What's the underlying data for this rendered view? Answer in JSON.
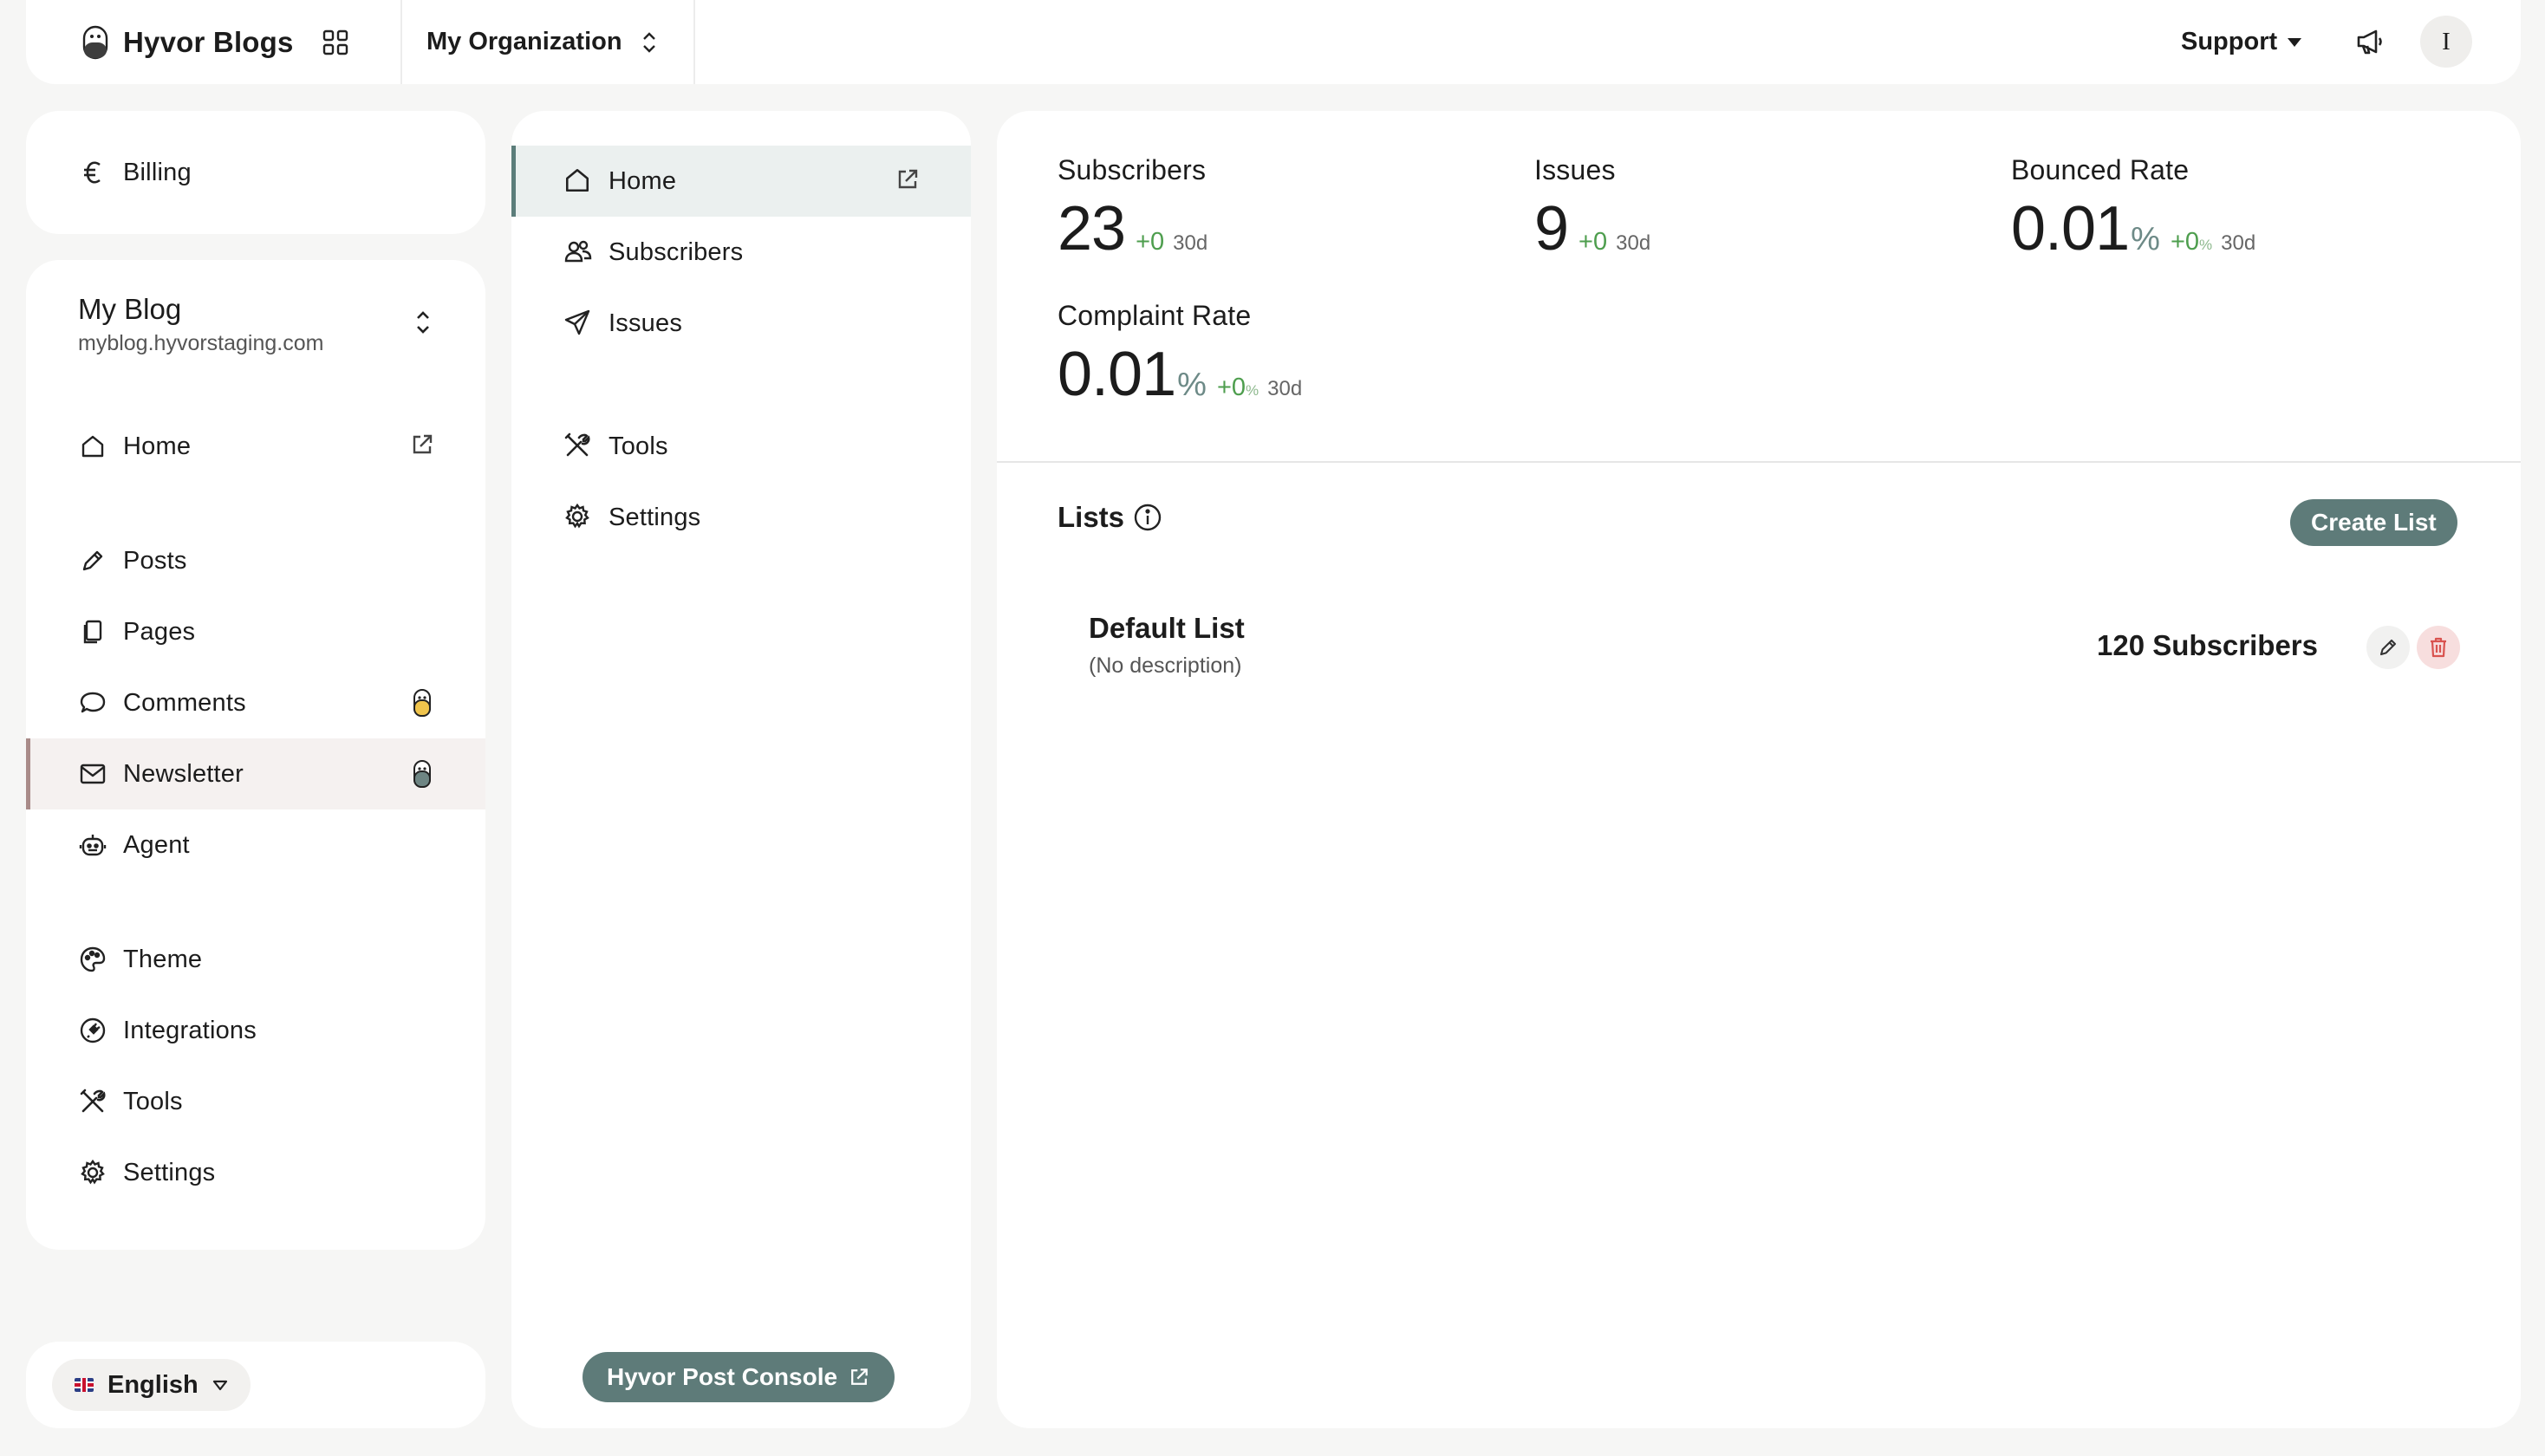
{
  "topbar": {
    "brand": "Hyvor Blogs",
    "organization": "My Organization",
    "support": "Support",
    "avatar_initial": "I"
  },
  "billing": {
    "label": "Billing",
    "icon": "euro-icon"
  },
  "blog": {
    "name": "My Blog",
    "url": "myblog.hyvorstaging.com",
    "nav": [
      {
        "label": "Home",
        "icon": "home-icon"
      },
      {
        "label": "Posts",
        "icon": "pencil-icon"
      },
      {
        "label": "Pages",
        "icon": "pages-icon"
      },
      {
        "label": "Comments",
        "icon": "chat-bubble-icon"
      },
      {
        "label": "Newsletter",
        "icon": "envelope-icon"
      },
      {
        "label": "Agent",
        "icon": "robot-icon"
      },
      {
        "label": "Theme",
        "icon": "palette-icon"
      },
      {
        "label": "Integrations",
        "icon": "plug-icon"
      },
      {
        "label": "Tools",
        "icon": "tools-icon"
      },
      {
        "label": "Settings",
        "icon": "gear-icon"
      }
    ],
    "active": "Newsletter"
  },
  "language": {
    "label": "English"
  },
  "newsletter_nav": {
    "items": [
      {
        "label": "Home",
        "icon": "home-icon"
      },
      {
        "label": "Subscribers",
        "icon": "users-icon"
      },
      {
        "label": "Issues",
        "icon": "send-icon"
      },
      {
        "label": "Tools",
        "icon": "tools-icon"
      },
      {
        "label": "Settings",
        "icon": "gear-icon"
      }
    ],
    "active": "Home",
    "console_button": "Hyvor Post Console"
  },
  "stats": {
    "subscribers": {
      "label": "Subscribers",
      "value": "23",
      "delta": "+0",
      "period": "30d"
    },
    "issues": {
      "label": "Issues",
      "value": "9",
      "delta": "+0",
      "period": "30d"
    },
    "bounced": {
      "label": "Bounced Rate",
      "value": "0.01",
      "unit": "%",
      "delta": "+0",
      "delta_unit": "%",
      "period": "30d"
    },
    "complaint": {
      "label": "Complaint Rate",
      "value": "0.01",
      "unit": "%",
      "delta": "+0",
      "delta_unit": "%",
      "period": "30d"
    }
  },
  "lists": {
    "title": "Lists",
    "create_button": "Create List",
    "items": [
      {
        "name": "Default List",
        "description": "(No description)",
        "count": "120 Subscribers"
      }
    ]
  },
  "colors": {
    "accent": "#5e7b79",
    "newsletter_active": "#a98b89",
    "delta_green": "#4e9e4e",
    "delete_bg": "#f7dede"
  }
}
